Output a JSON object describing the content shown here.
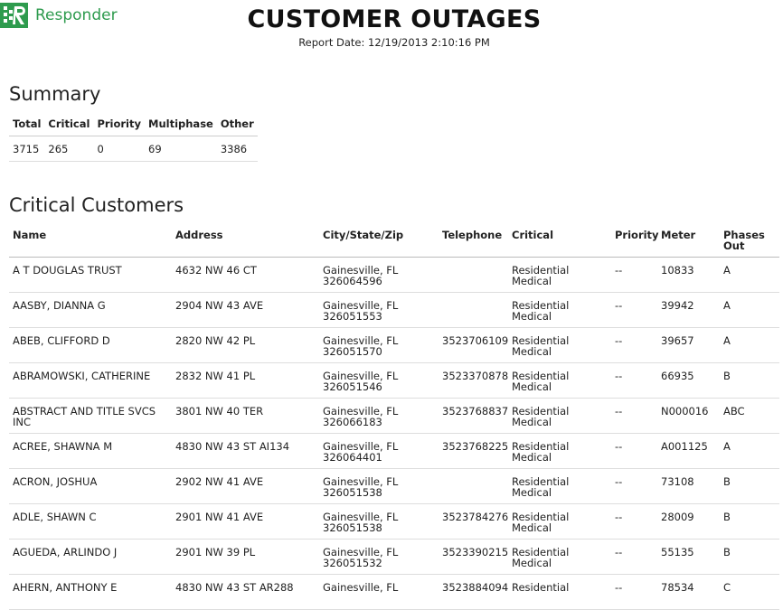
{
  "brand": {
    "name": "Responder",
    "accent": "#2e9b4e"
  },
  "header": {
    "title": "CUSTOMER OUTAGES",
    "report_date": "Report Date: 12/19/2013 2:10:16 PM"
  },
  "summary": {
    "heading": "Summary",
    "columns": [
      "Total",
      "Critical",
      "Priority",
      "Multiphase",
      "Other"
    ],
    "values": [
      "3715",
      "265",
      "0",
      "69",
      "3386"
    ]
  },
  "critical": {
    "heading": "Critical Customers",
    "columns": [
      "Name",
      "Address",
      "City/State/Zip",
      "Telephone",
      "Critical",
      "Priority",
      "Meter",
      "Phases Out"
    ],
    "rows": [
      [
        "A T DOUGLAS TRUST",
        "4632 NW 46 CT",
        "Gainesville, FL 326064596",
        "",
        "Residential Medical",
        "--",
        "10833",
        "A"
      ],
      [
        "AASBY, DIANNA G",
        "2904 NW 43 AVE",
        "Gainesville, FL 326051553",
        "",
        "Residential Medical",
        "--",
        "39942",
        "A"
      ],
      [
        "ABEB, CLIFFORD D",
        "2820 NW 42 PL",
        "Gainesville, FL 326051570",
        "3523706109",
        "Residential Medical",
        "--",
        "39657",
        "A"
      ],
      [
        "ABRAMOWSKI, CATHERINE",
        "2832 NW 41 PL",
        "Gainesville, FL 326051546",
        "3523370878",
        "Residential Medical",
        "--",
        "66935",
        "B"
      ],
      [
        "ABSTRACT AND TITLE SVCS INC",
        "3801 NW 40 TER",
        "Gainesville, FL 326066183",
        "3523768837",
        "Residential Medical",
        "--",
        "N000016",
        "ABC"
      ],
      [
        "ACREE, SHAWNA M",
        "4830 NW 43 ST AI134",
        "Gainesville, FL 326064401",
        "3523768225",
        "Residential Medical",
        "--",
        "A001125",
        "A"
      ],
      [
        "ACRON, JOSHUA",
        "2902 NW 41 AVE",
        "Gainesville, FL 326051538",
        "",
        "Residential Medical",
        "--",
        "73108",
        "B"
      ],
      [
        "ADLE, SHAWN C",
        "2901 NW 41 AVE",
        "Gainesville, FL 326051538",
        "3523784276",
        "Residential Medical",
        "--",
        "28009",
        "B"
      ],
      [
        "AGUEDA, ARLINDO J",
        "2901 NW 39 PL",
        "Gainesville, FL 326051532",
        "3523390215",
        "Residential Medical",
        "--",
        "55135",
        "B"
      ],
      [
        "AHERN, ANTHONY E",
        "4830 NW 43 ST AR288",
        "Gainesville, FL",
        "3523884094",
        "Residential",
        "--",
        "78534",
        "C"
      ]
    ]
  }
}
